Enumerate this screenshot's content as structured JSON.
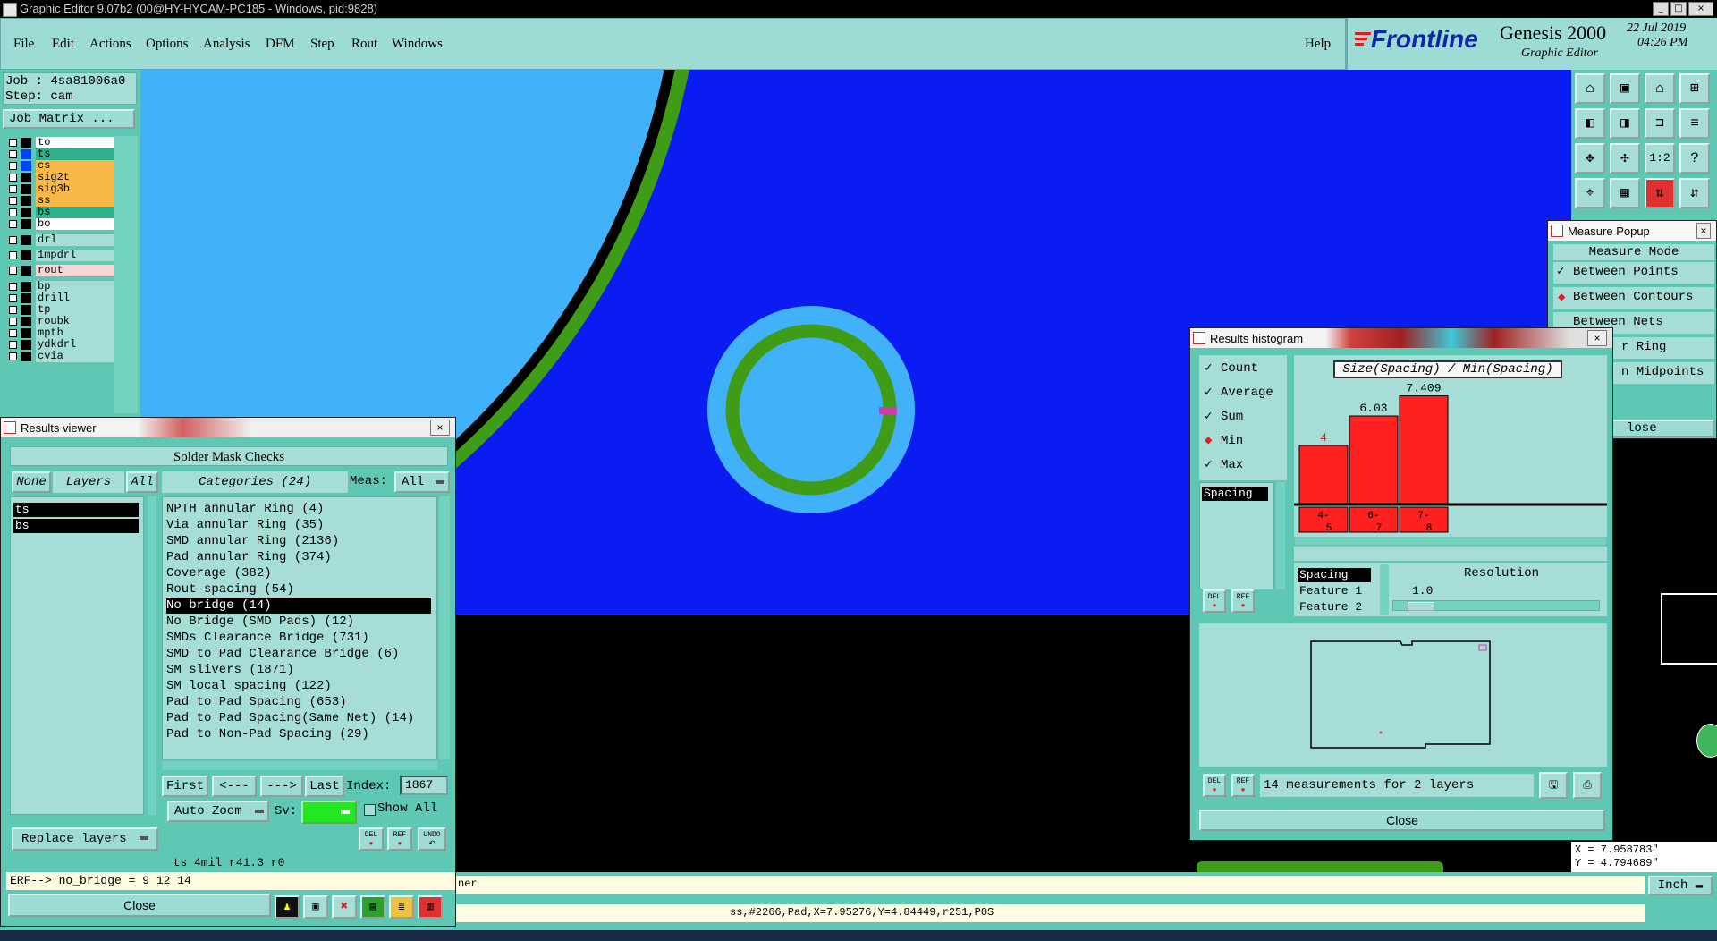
{
  "window": {
    "title": "Graphic Editor 9.07b2 (00@HY-HYCAM-PC185 - Windows, pid:9828)"
  },
  "menu": {
    "items": [
      "File",
      "Edit",
      "Actions",
      "Options",
      "Analysis",
      "DFM",
      "Step",
      "Rout",
      "Windows"
    ],
    "help": "Help"
  },
  "brand": {
    "logo": "Frontline",
    "product": "Genesis 2000",
    "subtitle": "Graphic Editor",
    "date": "22 Jul 2019",
    "time": "04:26 PM"
  },
  "left_panel": {
    "job": "Job : 4sa81006a0",
    "step": "Step: cam",
    "job_matrix": "Job Matrix ...",
    "layers": [
      {
        "name": "to",
        "color": "#ffffff",
        "swatch": "#000000"
      },
      {
        "name": "ts",
        "color": "#2fb08a",
        "swatch": "#0044ff"
      },
      {
        "name": "cs",
        "color": "#f8b848",
        "swatch": "#0044ff"
      },
      {
        "name": "sig2t",
        "color": "#f8b848",
        "swatch": "#000000"
      },
      {
        "name": "sig3b",
        "color": "#f8b848",
        "swatch": "#000000"
      },
      {
        "name": "ss",
        "color": "#f8b848",
        "swatch": "#000000"
      },
      {
        "name": "bs",
        "color": "#2fb08a",
        "swatch": "#000000"
      },
      {
        "name": "bo",
        "color": "#ffffff",
        "swatch": "#000000"
      },
      {
        "name": "drl",
        "color": "#a6ddd6",
        "swatch": "#000000"
      },
      {
        "name": "1mpdrl",
        "color": "#a6ddd6",
        "swatch": "#000000"
      },
      {
        "name": "rout",
        "color": "#f4d8d8",
        "swatch": "#000000"
      },
      {
        "name": "bp",
        "color": "#a6ddd6",
        "swatch": "#000000"
      },
      {
        "name": "drill",
        "color": "#a6ddd6",
        "swatch": "#000000"
      },
      {
        "name": "tp",
        "color": "#a6ddd6",
        "swatch": "#000000"
      },
      {
        "name": "roubk",
        "color": "#a6ddd6",
        "swatch": "#000000"
      },
      {
        "name": "mpth",
        "color": "#a6ddd6",
        "swatch": "#000000"
      },
      {
        "name": "ydkdrl",
        "color": "#a6ddd6",
        "swatch": "#000000"
      },
      {
        "name": "cvia",
        "color": "#a6ddd6",
        "swatch": "#000000"
      }
    ]
  },
  "results_viewer": {
    "title": "Results viewer",
    "header": "Solder Mask Checks",
    "none_btn": "None",
    "layers_label": "Layers",
    "all_btn": "All",
    "categories_label": "Categories (24)",
    "meas_label": "Meas:",
    "meas_value": "All",
    "layer_list": [
      "ts",
      "bs"
    ],
    "categories": [
      "NPTH annular Ring (4)",
      "Via annular Ring (35)",
      "SMD annular Ring (2136)",
      "Pad annular Ring (374)",
      "Coverage (382)",
      "Rout spacing (54)",
      "No bridge (14)",
      "No Bridge (SMD Pads) (12)",
      "SMDs Clearance Bridge (731)",
      "SMD to Pad Clearance Bridge (6)",
      "SM slivers (1871)",
      "SM local spacing (122)",
      "Pad to Pad Spacing (653)",
      "Pad to Pad Spacing(Same Net) (14)",
      "Pad to Non-Pad Spacing (29)"
    ],
    "selected_category": "No bridge (14)",
    "first": "First",
    "prev": "<---",
    "next": "--->",
    "last": "Last",
    "index_label": "Index:",
    "index_value": "1867",
    "auto_zoom": "Auto Zoom",
    "sv_label": "Sv:",
    "show_all": "Show All",
    "replace_layers": "Replace layers",
    "del": "DEL",
    "ref": "REF",
    "undo": "UNDO",
    "status_line": "ts 4mil  r41.3  r0",
    "close": "Close"
  },
  "histogram": {
    "title": "Results histogram",
    "options": [
      {
        "label": "Count",
        "type": "check"
      },
      {
        "label": "Average",
        "type": "check"
      },
      {
        "label": "Sum",
        "type": "check"
      },
      {
        "label": "Min",
        "type": "diamond"
      },
      {
        "label": "Max",
        "type": "check"
      }
    ],
    "chart_title": "Size(Spacing) / Min(Spacing)",
    "list_item": "Spacing",
    "field_list": [
      "Spacing",
      "Feature 1",
      "Feature 2"
    ],
    "resolution_label": "Resolution",
    "resolution_value": "1.0",
    "measurements": "14 measurements for 2 layers",
    "close": "Close",
    "del": "DEL",
    "ref": "REF"
  },
  "chart_data": {
    "type": "bar",
    "categories": [
      "4-5",
      "6-7",
      "7-8"
    ],
    "values": [
      4,
      6.03,
      7.409
    ],
    "value_labels": [
      "4",
      "6.03",
      "7.409"
    ],
    "title": "Size(Spacing) / Min(Spacing)",
    "bar_color": "#ff2020",
    "ylim": [
      0,
      8
    ],
    "grid": false
  },
  "measure_popup": {
    "title": "Measure Popup",
    "mode_label": "Measure Mode",
    "options": [
      "Between Points",
      "Between Contours",
      "Between Nets",
      "r Ring",
      "n Midpoints"
    ],
    "selected": "Between Contours",
    "close": "lose"
  },
  "coords": {
    "x": "X = 7.958783\"",
    "y": "Y = 4.794689\"",
    "unit": "Inch"
  },
  "command_line": {
    "text": "ERF--> no_bridge = 9 12 14",
    "right_text": "ner"
  },
  "bottom_status": "ss,#2266,Pad,X=7.95276,Y=4.84449,r251,POS",
  "colors": {
    "canvas_blue": "#0a1cf2",
    "light_blue": "#41b1f9",
    "green": "#3f9c16",
    "panel": "#5fc8b4"
  }
}
